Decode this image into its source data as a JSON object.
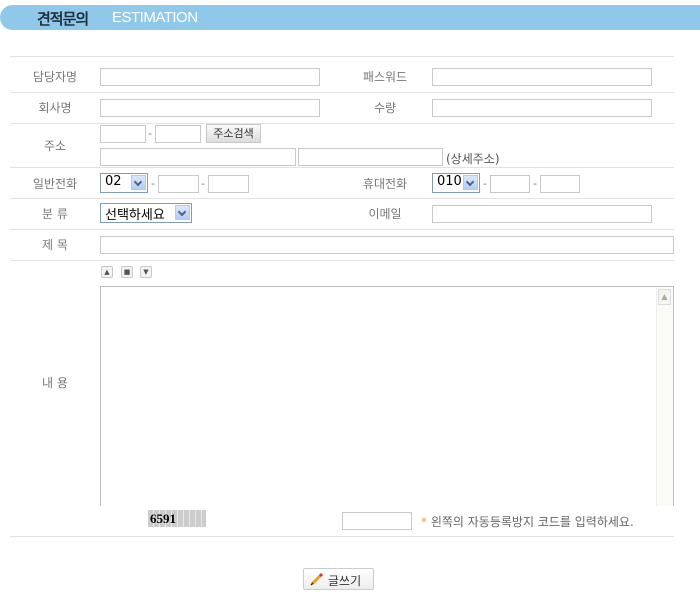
{
  "header": {
    "title_ko": "견적문의",
    "title_en": "ESTIMATION"
  },
  "form": {
    "labels": {
      "name": "담당자명",
      "password": "패스워드",
      "company": "회사명",
      "quantity": "수량",
      "address": "주소",
      "address_detail": "(상세주소)",
      "phone": "일반전화",
      "mobile": "휴대전화",
      "category": "분 류",
      "email": "이메일",
      "subject": "제 목",
      "content": "내 용"
    },
    "address_search_button": "주소검색",
    "phone_prefix": "02",
    "mobile_prefix": "010",
    "category_selected": "선택하세요",
    "dash": "-",
    "captcha_code": "6591",
    "captcha_hint_star": "*",
    "captcha_hint": "왼쪽의 자동등록방지 코드를 입력하세요.",
    "size_controls": [
      "▲",
      "■",
      "▼"
    ],
    "submit_label": "글쓰기"
  }
}
